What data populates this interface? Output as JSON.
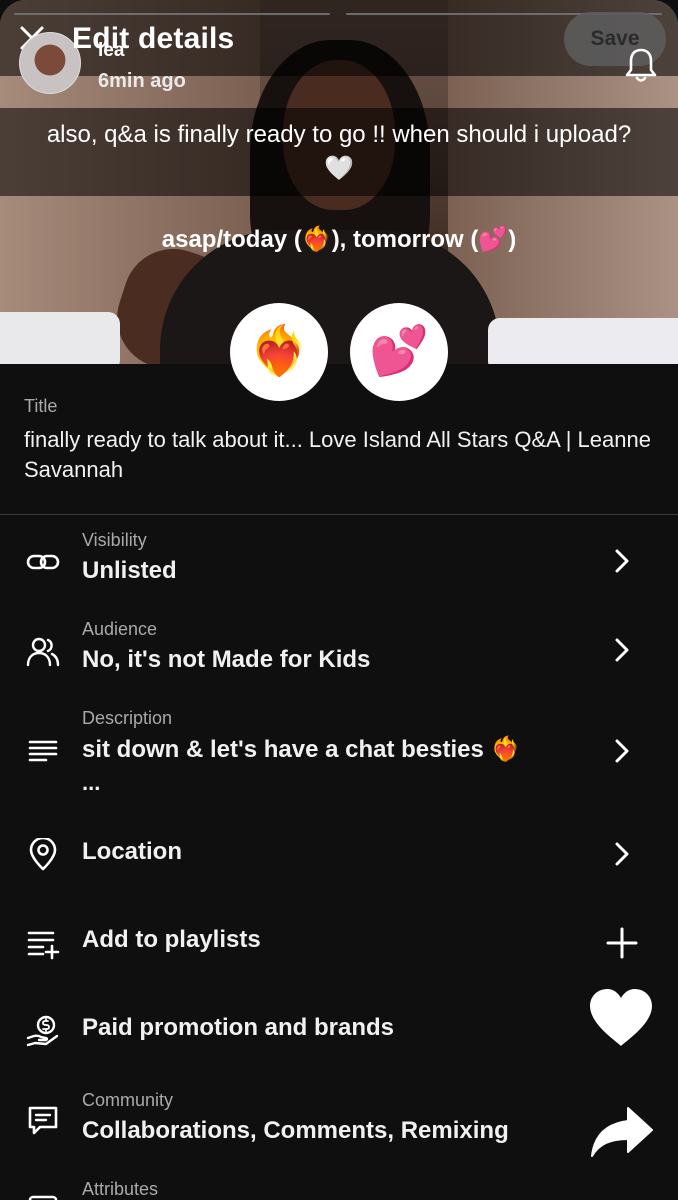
{
  "header": {
    "title": "Edit details",
    "save_label": "Save"
  },
  "story": {
    "name": "lea",
    "time": "6min ago",
    "caption": "also, q&a is finally ready to go !! when should i upload? 🤍",
    "poll_question": "asap/today (❤️‍🔥), tomorrow (💕)",
    "poll_options": [
      "❤️‍🔥",
      "💕"
    ]
  },
  "title_field": {
    "label": "Title",
    "value": "finally ready to talk about it... Love Island All Stars Q&A | Leanne Savannah"
  },
  "rows": [
    {
      "label": "Visibility",
      "value": "Unlisted",
      "icon": "link-icon",
      "action": "chevron"
    },
    {
      "label": "Audience",
      "value": "No, it's not Made for Kids",
      "icon": "people-icon",
      "action": "chevron"
    },
    {
      "label": "Description",
      "value": "sit down & let's have a chat besties ❤️‍🔥",
      "more": "...",
      "icon": "description-icon",
      "action": "chevron"
    },
    {
      "label": "",
      "value": "Location",
      "icon": "location-pin-icon",
      "action": "chevron"
    },
    {
      "label": "",
      "value": "Add to playlists",
      "icon": "playlist-add-icon",
      "action": "plus"
    },
    {
      "label": "",
      "value": "Paid promotion and brands",
      "icon": "paid-promotion-icon",
      "action": "none"
    },
    {
      "label": "Community",
      "value": "Collaborations, Comments, Remixing",
      "icon": "comment-icon",
      "action": "none"
    },
    {
      "label": "Attributes",
      "value": "",
      "icon": "attributes-icon",
      "action": "chevron"
    }
  ],
  "overlay_actions": {
    "like_icon": "heart-icon",
    "share_icon": "share-arrow-icon"
  }
}
